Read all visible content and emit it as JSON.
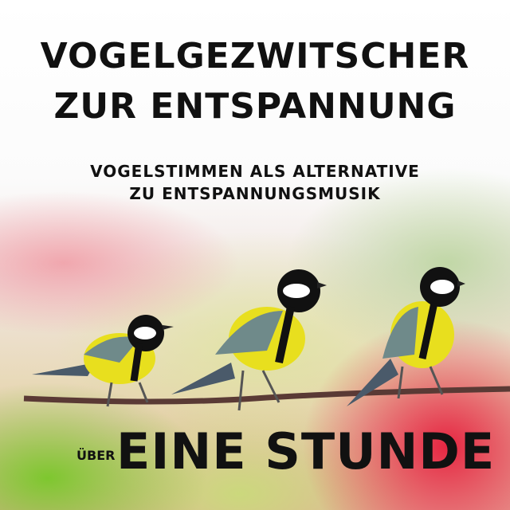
{
  "cover": {
    "title_line1": "VOGELGEZWITSCHER",
    "title_line2": "ZUR ENTSPANNUNG",
    "subtitle_line1": "VOGELSTIMMEN ALS ALTERNATIVE",
    "subtitle_line2": "ZU ENTSPANNUNGSMUSIK",
    "duration_prefix": "ÜBER",
    "duration": "EINE STUNDE"
  },
  "colors": {
    "text": "#111111",
    "bird_yellow": "#e8df1e",
    "accent_red": "#e61e3c",
    "accent_green": "#78c828"
  }
}
